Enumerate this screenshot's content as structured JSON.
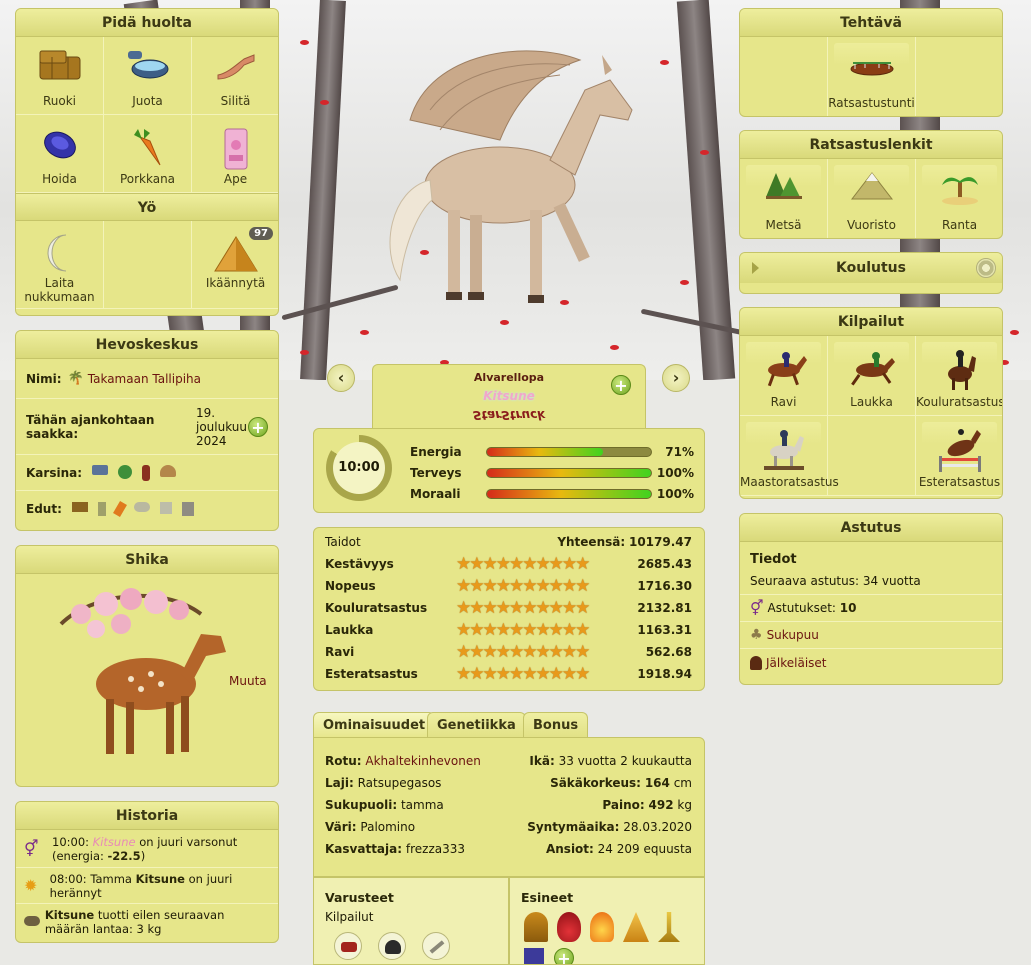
{
  "care": {
    "title": "Pidä huolta",
    "items": [
      {
        "label": "Ruoki",
        "icon": "hay-bale-icon"
      },
      {
        "label": "Juota",
        "icon": "water-bowl-icon"
      },
      {
        "label": "Silitä",
        "icon": "hand-icon"
      },
      {
        "label": "Hoida",
        "icon": "brush-icon"
      },
      {
        "label": "Porkkana",
        "icon": "carrot-icon"
      },
      {
        "label": "Ape",
        "icon": "mash-bag-icon"
      }
    ]
  },
  "night": {
    "title": "Yö",
    "sleep_label": "Laita nukkumaan",
    "age_label": "Ikäännytä",
    "age_badge": "97"
  },
  "equestrian_center": {
    "title": "Hevoskeskus",
    "name_label": "Nimi:",
    "name_value": "Takamaan Tallipiha",
    "until_label": "Tähän ajankohtaan saakka:",
    "until_value": "19. joulukuu 2024",
    "stall_label": "Karsina:",
    "perks_label": "Edut:"
  },
  "companion": {
    "title": "Shika",
    "change_label": "Muuta"
  },
  "history": {
    "title": "Historia",
    "entries": [
      {
        "time": "10:00:",
        "name": "Kitsune",
        "text": "on juuri varsonut",
        "extra_prefix": "(energia:",
        "extra_value": "-22.5",
        "extra_suffix": ")",
        "icon": "gender-icon"
      },
      {
        "time": "08:00:",
        "prefix": "Tamma",
        "name": "Kitsune",
        "text": "on juuri herännyt",
        "icon": "sun-icon"
      },
      {
        "name": "Kitsune",
        "text": "tuotti eilen seuraavan määrän lantaa: 3 kg",
        "icon": "manure-icon"
      }
    ]
  },
  "horse": {
    "affix": "Alvarellopa",
    "name": "Kitsune",
    "signature": "StarStruck",
    "time": "10:00",
    "stats": [
      {
        "label": "Energia",
        "value": "71%",
        "fraction": 0.71
      },
      {
        "label": "Terveys",
        "value": "100%",
        "fraction": 1.0
      },
      {
        "label": "Moraali",
        "value": "100%",
        "fraction": 1.0
      }
    ]
  },
  "skills": {
    "title": "Taidot",
    "total_label": "Yhteensä:",
    "total_value": "10179.47",
    "rows": [
      {
        "label": "Kestävyys",
        "value": "2685.43",
        "stars": 10
      },
      {
        "label": "Nopeus",
        "value": "1716.30",
        "stars": 10
      },
      {
        "label": "Kouluratsastus",
        "value": "2132.81",
        "stars": 10
      },
      {
        "label": "Laukka",
        "value": "1163.31",
        "stars": 10
      },
      {
        "label": "Ravi",
        "value": "562.68",
        "stars": 10
      },
      {
        "label": "Esteratsastus",
        "value": "1918.94",
        "stars": 10
      }
    ]
  },
  "tabs": [
    "Ominaisuudet",
    "Genetiikka",
    "Bonus"
  ],
  "characteristics": {
    "breed_label": "Rotu:",
    "breed_value": "Akhaltekinhevonen",
    "age_label": "Ikä:",
    "age_value": "33 vuotta 2 kuukautta",
    "species_label": "Laji:",
    "species_value": "Ratsupegasos",
    "height_label": "Säkäkorkeus:",
    "height_value": "164",
    "height_unit": "cm",
    "sex_label": "Sukupuoli:",
    "sex_value": "tamma",
    "weight_label": "Paino:",
    "weight_value": "492",
    "weight_unit": "kg",
    "color_label": "Väri:",
    "color_value": "Palomino",
    "birth_label": "Syntymäaika:",
    "birth_value": "28.03.2020",
    "breeder_label": "Kasvattaja:",
    "breeder_value": "frezza333",
    "earnings_label": "Ansiot:",
    "earnings_value": "24 209 equusta"
  },
  "equipment": {
    "title": "Varusteet",
    "subtitle": "Kilpailut"
  },
  "items": {
    "title": "Esineet"
  },
  "tasks": {
    "title": "Tehtävä",
    "lesson_label": "Ratsastustunti"
  },
  "rides": {
    "title": "Ratsastuslenkit",
    "items": [
      {
        "label": "Metsä",
        "icon": "forest-icon"
      },
      {
        "label": "Vuoristo",
        "icon": "mountain-icon"
      },
      {
        "label": "Ranta",
        "icon": "beach-icon"
      }
    ]
  },
  "training": {
    "title": "Koulutus"
  },
  "competitions": {
    "title": "Kilpailut",
    "items": [
      {
        "label": "Ravi"
      },
      {
        "label": "Laukka"
      },
      {
        "label": "Kouluratsastus"
      },
      {
        "label": "Maastoratsastus"
      },
      {
        "label": ""
      },
      {
        "label": "Esteratsastus"
      }
    ]
  },
  "breeding": {
    "title": "Astutus",
    "info_title": "Tiedot",
    "next_label": "Seuraava astutus: 34 vuotta",
    "coverings_label": "Astutukset:",
    "coverings_value": "10",
    "pedigree_label": "Sukupuu",
    "offspring_label": "Jälkeläiset"
  }
}
